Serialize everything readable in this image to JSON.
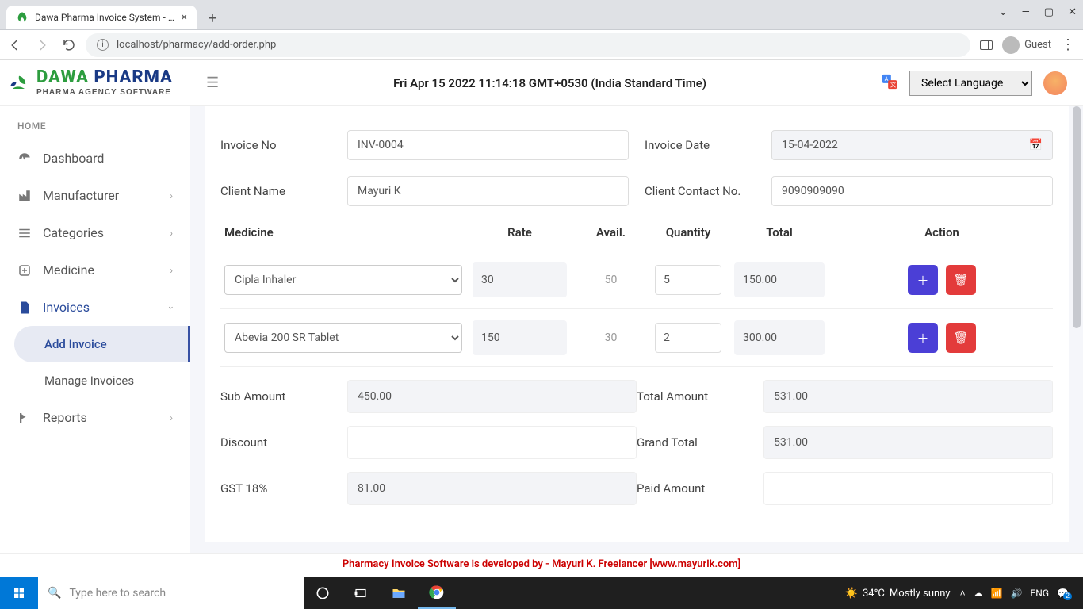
{
  "browser": {
    "tab_title": "Dawa Pharma Invoice System - M",
    "url": "localhost/pharmacy/add-order.php",
    "guest_label": "Guest"
  },
  "header": {
    "logo_main_green": "DAWA",
    "logo_main_blue": " PHARMA",
    "logo_sub": "PHARMA AGENCY SOFTWARE",
    "date_line": "Fri Apr 15 2022 11:14:18 GMT+0530 (India Standard Time)",
    "lang_selected": "Select Language"
  },
  "sidebar": {
    "section_label": "HOME",
    "items": [
      {
        "label": "Dashboard",
        "icon": "dashboard-icon"
      },
      {
        "label": "Manufacturer",
        "icon": "manufacturer-icon",
        "expandable": true
      },
      {
        "label": "Categories",
        "icon": "categories-icon",
        "expandable": true
      },
      {
        "label": "Medicine",
        "icon": "medicine-icon",
        "expandable": true
      },
      {
        "label": "Invoices",
        "icon": "invoices-icon",
        "expandable": true,
        "expanded": true
      },
      {
        "label": "Reports",
        "icon": "reports-icon",
        "expandable": true
      }
    ],
    "invoice_children": [
      {
        "label": "Add Invoice",
        "active": true
      },
      {
        "label": "Manage Invoices"
      }
    ]
  },
  "form": {
    "labels": {
      "invoice_no": "Invoice No",
      "invoice_date": "Invoice Date",
      "client_name": "Client Name",
      "client_contact": "Client Contact No.",
      "sub_amount": "Sub Amount",
      "total_amount": "Total Amount",
      "discount": "Discount",
      "grand_total": "Grand Total",
      "gst": "GST 18%",
      "paid_amount": "Paid Amount"
    },
    "values": {
      "invoice_no": "INV-0004",
      "invoice_date": "15-04-2022",
      "client_name": "Mayuri K",
      "client_contact": "9090909090",
      "sub_amount": "450.00",
      "total_amount": "531.00",
      "discount": "",
      "grand_total": "531.00",
      "gst": "81.00",
      "paid_amount": ""
    },
    "table": {
      "headers": {
        "medicine": "Medicine",
        "rate": "Rate",
        "avail": "Avail.",
        "quantity": "Quantity",
        "total": "Total",
        "action": "Action"
      },
      "rows": [
        {
          "medicine": "Cipla Inhaler",
          "rate": "30",
          "avail": "50",
          "qty": "5",
          "total": "150.00"
        },
        {
          "medicine": "Abevia 200 SR Tablet",
          "rate": "150",
          "avail": "30",
          "qty": "2",
          "total": "300.00"
        }
      ]
    }
  },
  "footer": {
    "credit_prefix": "Pharmacy Invoice Software is developed by - Mayuri K. Freelancer  ",
    "credit_link": "[www.mayurik.com]"
  },
  "taskbar": {
    "search_placeholder": "Type here to search",
    "weather_temp": "34°C",
    "weather_text": "Mostly sunny",
    "lang": "ENG",
    "time": "",
    "notif_badge": "2"
  }
}
